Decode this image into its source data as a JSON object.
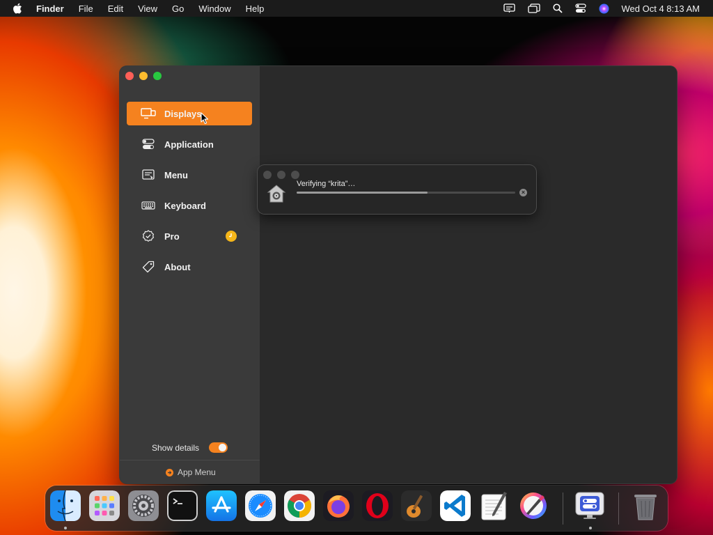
{
  "menubar": {
    "app_name": "Finder",
    "items": [
      "File",
      "Edit",
      "View",
      "Go",
      "Window",
      "Help"
    ],
    "clock": "Wed Oct 4  8:13 AM"
  },
  "sidebar": {
    "items": [
      {
        "label": "Displays",
        "icon": "display-icon",
        "active": true
      },
      {
        "label": "Application",
        "icon": "toggles-icon",
        "active": false
      },
      {
        "label": "Menu",
        "icon": "menu-icon",
        "active": false
      },
      {
        "label": "Keyboard",
        "icon": "keyboard-icon",
        "active": false
      },
      {
        "label": "Pro",
        "icon": "badge-check-icon",
        "active": false
      },
      {
        "label": "About",
        "icon": "tag-icon",
        "active": false
      }
    ],
    "show_details_label": "Show details",
    "show_details_on": true,
    "app_menu_label": "App Menu"
  },
  "verify_dialog": {
    "text": "Verifying “krita”…",
    "progress": 0.6
  },
  "dock": {
    "apps": [
      "Finder",
      "Launchpad",
      "System Settings",
      "Terminal",
      "App Store",
      "Safari",
      "Chrome",
      "Firefox",
      "Opera",
      "GarageBand",
      "Visual Studio Code",
      "TextEdit",
      "Krita",
      "Menu Bar Controller",
      "Trash"
    ]
  },
  "colors": {
    "accent": "#f5821f",
    "badge": "#f5b61a"
  }
}
